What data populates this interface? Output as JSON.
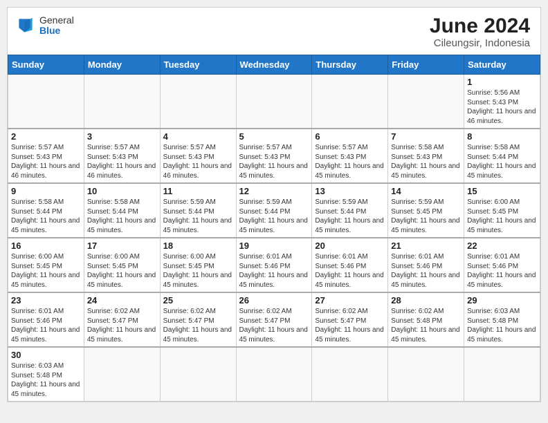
{
  "header": {
    "logo_general": "General",
    "logo_blue": "Blue",
    "month_year": "June 2024",
    "location": "Cileungsir, Indonesia"
  },
  "weekdays": [
    "Sunday",
    "Monday",
    "Tuesday",
    "Wednesday",
    "Thursday",
    "Friday",
    "Saturday"
  ],
  "days": [
    {
      "date": "",
      "info": ""
    },
    {
      "date": "",
      "info": ""
    },
    {
      "date": "",
      "info": ""
    },
    {
      "date": "",
      "info": ""
    },
    {
      "date": "",
      "info": ""
    },
    {
      "date": "",
      "info": ""
    },
    {
      "date": "1",
      "info": "Sunrise: 5:56 AM\nSunset: 5:43 PM\nDaylight: 11 hours and 46 minutes."
    },
    {
      "date": "2",
      "info": "Sunrise: 5:57 AM\nSunset: 5:43 PM\nDaylight: 11 hours and 46 minutes."
    },
    {
      "date": "3",
      "info": "Sunrise: 5:57 AM\nSunset: 5:43 PM\nDaylight: 11 hours and 46 minutes."
    },
    {
      "date": "4",
      "info": "Sunrise: 5:57 AM\nSunset: 5:43 PM\nDaylight: 11 hours and 46 minutes."
    },
    {
      "date": "5",
      "info": "Sunrise: 5:57 AM\nSunset: 5:43 PM\nDaylight: 11 hours and 45 minutes."
    },
    {
      "date": "6",
      "info": "Sunrise: 5:57 AM\nSunset: 5:43 PM\nDaylight: 11 hours and 45 minutes."
    },
    {
      "date": "7",
      "info": "Sunrise: 5:58 AM\nSunset: 5:43 PM\nDaylight: 11 hours and 45 minutes."
    },
    {
      "date": "8",
      "info": "Sunrise: 5:58 AM\nSunset: 5:44 PM\nDaylight: 11 hours and 45 minutes."
    },
    {
      "date": "9",
      "info": "Sunrise: 5:58 AM\nSunset: 5:44 PM\nDaylight: 11 hours and 45 minutes."
    },
    {
      "date": "10",
      "info": "Sunrise: 5:58 AM\nSunset: 5:44 PM\nDaylight: 11 hours and 45 minutes."
    },
    {
      "date": "11",
      "info": "Sunrise: 5:59 AM\nSunset: 5:44 PM\nDaylight: 11 hours and 45 minutes."
    },
    {
      "date": "12",
      "info": "Sunrise: 5:59 AM\nSunset: 5:44 PM\nDaylight: 11 hours and 45 minutes."
    },
    {
      "date": "13",
      "info": "Sunrise: 5:59 AM\nSunset: 5:44 PM\nDaylight: 11 hours and 45 minutes."
    },
    {
      "date": "14",
      "info": "Sunrise: 5:59 AM\nSunset: 5:45 PM\nDaylight: 11 hours and 45 minutes."
    },
    {
      "date": "15",
      "info": "Sunrise: 6:00 AM\nSunset: 5:45 PM\nDaylight: 11 hours and 45 minutes."
    },
    {
      "date": "16",
      "info": "Sunrise: 6:00 AM\nSunset: 5:45 PM\nDaylight: 11 hours and 45 minutes."
    },
    {
      "date": "17",
      "info": "Sunrise: 6:00 AM\nSunset: 5:45 PM\nDaylight: 11 hours and 45 minutes."
    },
    {
      "date": "18",
      "info": "Sunrise: 6:00 AM\nSunset: 5:45 PM\nDaylight: 11 hours and 45 minutes."
    },
    {
      "date": "19",
      "info": "Sunrise: 6:01 AM\nSunset: 5:46 PM\nDaylight: 11 hours and 45 minutes."
    },
    {
      "date": "20",
      "info": "Sunrise: 6:01 AM\nSunset: 5:46 PM\nDaylight: 11 hours and 45 minutes."
    },
    {
      "date": "21",
      "info": "Sunrise: 6:01 AM\nSunset: 5:46 PM\nDaylight: 11 hours and 45 minutes."
    },
    {
      "date": "22",
      "info": "Sunrise: 6:01 AM\nSunset: 5:46 PM\nDaylight: 11 hours and 45 minutes."
    },
    {
      "date": "23",
      "info": "Sunrise: 6:01 AM\nSunset: 5:46 PM\nDaylight: 11 hours and 45 minutes."
    },
    {
      "date": "24",
      "info": "Sunrise: 6:02 AM\nSunset: 5:47 PM\nDaylight: 11 hours and 45 minutes."
    },
    {
      "date": "25",
      "info": "Sunrise: 6:02 AM\nSunset: 5:47 PM\nDaylight: 11 hours and 45 minutes."
    },
    {
      "date": "26",
      "info": "Sunrise: 6:02 AM\nSunset: 5:47 PM\nDaylight: 11 hours and 45 minutes."
    },
    {
      "date": "27",
      "info": "Sunrise: 6:02 AM\nSunset: 5:47 PM\nDaylight: 11 hours and 45 minutes."
    },
    {
      "date": "28",
      "info": "Sunrise: 6:02 AM\nSunset: 5:48 PM\nDaylight: 11 hours and 45 minutes."
    },
    {
      "date": "29",
      "info": "Sunrise: 6:03 AM\nSunset: 5:48 PM\nDaylight: 11 hours and 45 minutes."
    },
    {
      "date": "30",
      "info": "Sunrise: 6:03 AM\nSunset: 5:48 PM\nDaylight: 11 hours and 45 minutes."
    },
    {
      "date": "",
      "info": ""
    },
    {
      "date": "",
      "info": ""
    },
    {
      "date": "",
      "info": ""
    },
    {
      "date": "",
      "info": ""
    },
    {
      "date": "",
      "info": ""
    },
    {
      "date": "",
      "info": ""
    }
  ]
}
